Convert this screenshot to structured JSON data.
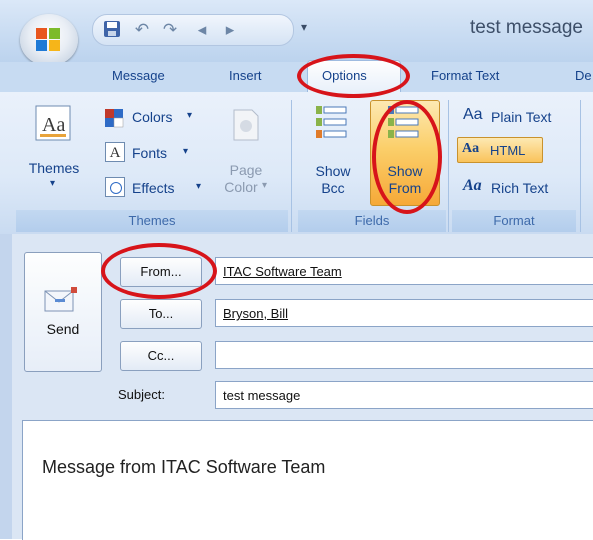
{
  "window": {
    "title": "test message"
  },
  "quick_access": {
    "save_icon": "save-icon",
    "undo_icon": "undo-icon",
    "redo_icon": "redo-icon",
    "prev_icon": "previous-item-icon",
    "next_icon": "next-item-icon",
    "customize_glyph": "▾"
  },
  "tabs": [
    {
      "label": "Message"
    },
    {
      "label": "Insert"
    },
    {
      "label": "Options"
    },
    {
      "label": "Format Text"
    },
    {
      "label": "De"
    }
  ],
  "ribbon": {
    "themes_group": {
      "caption": "Themes",
      "themes_button": "Themes",
      "colors_button": "Colors",
      "fonts_button": "Fonts",
      "effects_button": "Effects",
      "page_color_line1": "Page",
      "page_color_line2": "Color"
    },
    "fields_group": {
      "caption": "Fields",
      "show_bcc_line1": "Show",
      "show_bcc_line2": "Bcc",
      "show_from_line1": "Show",
      "show_from_line2": "From"
    },
    "format_group": {
      "caption": "Format",
      "plain_text": "Plain Text",
      "html": "HTML",
      "rich_text": "Rich Text",
      "aa_glyph": "Aa"
    }
  },
  "compose": {
    "send_label": "Send",
    "from_button": "From...",
    "from_value": "ITAC Software Team",
    "to_button": "To...",
    "to_value": "Bryson, Bill",
    "cc_button": "Cc...",
    "cc_value": "",
    "subject_label": "Subject:",
    "subject_value": "test message",
    "body_text": "Message from ITAC Software Team"
  },
  "colors": {
    "accent": "#15428b",
    "annotation": "#d7141a",
    "active_button": "#f9b94a"
  }
}
